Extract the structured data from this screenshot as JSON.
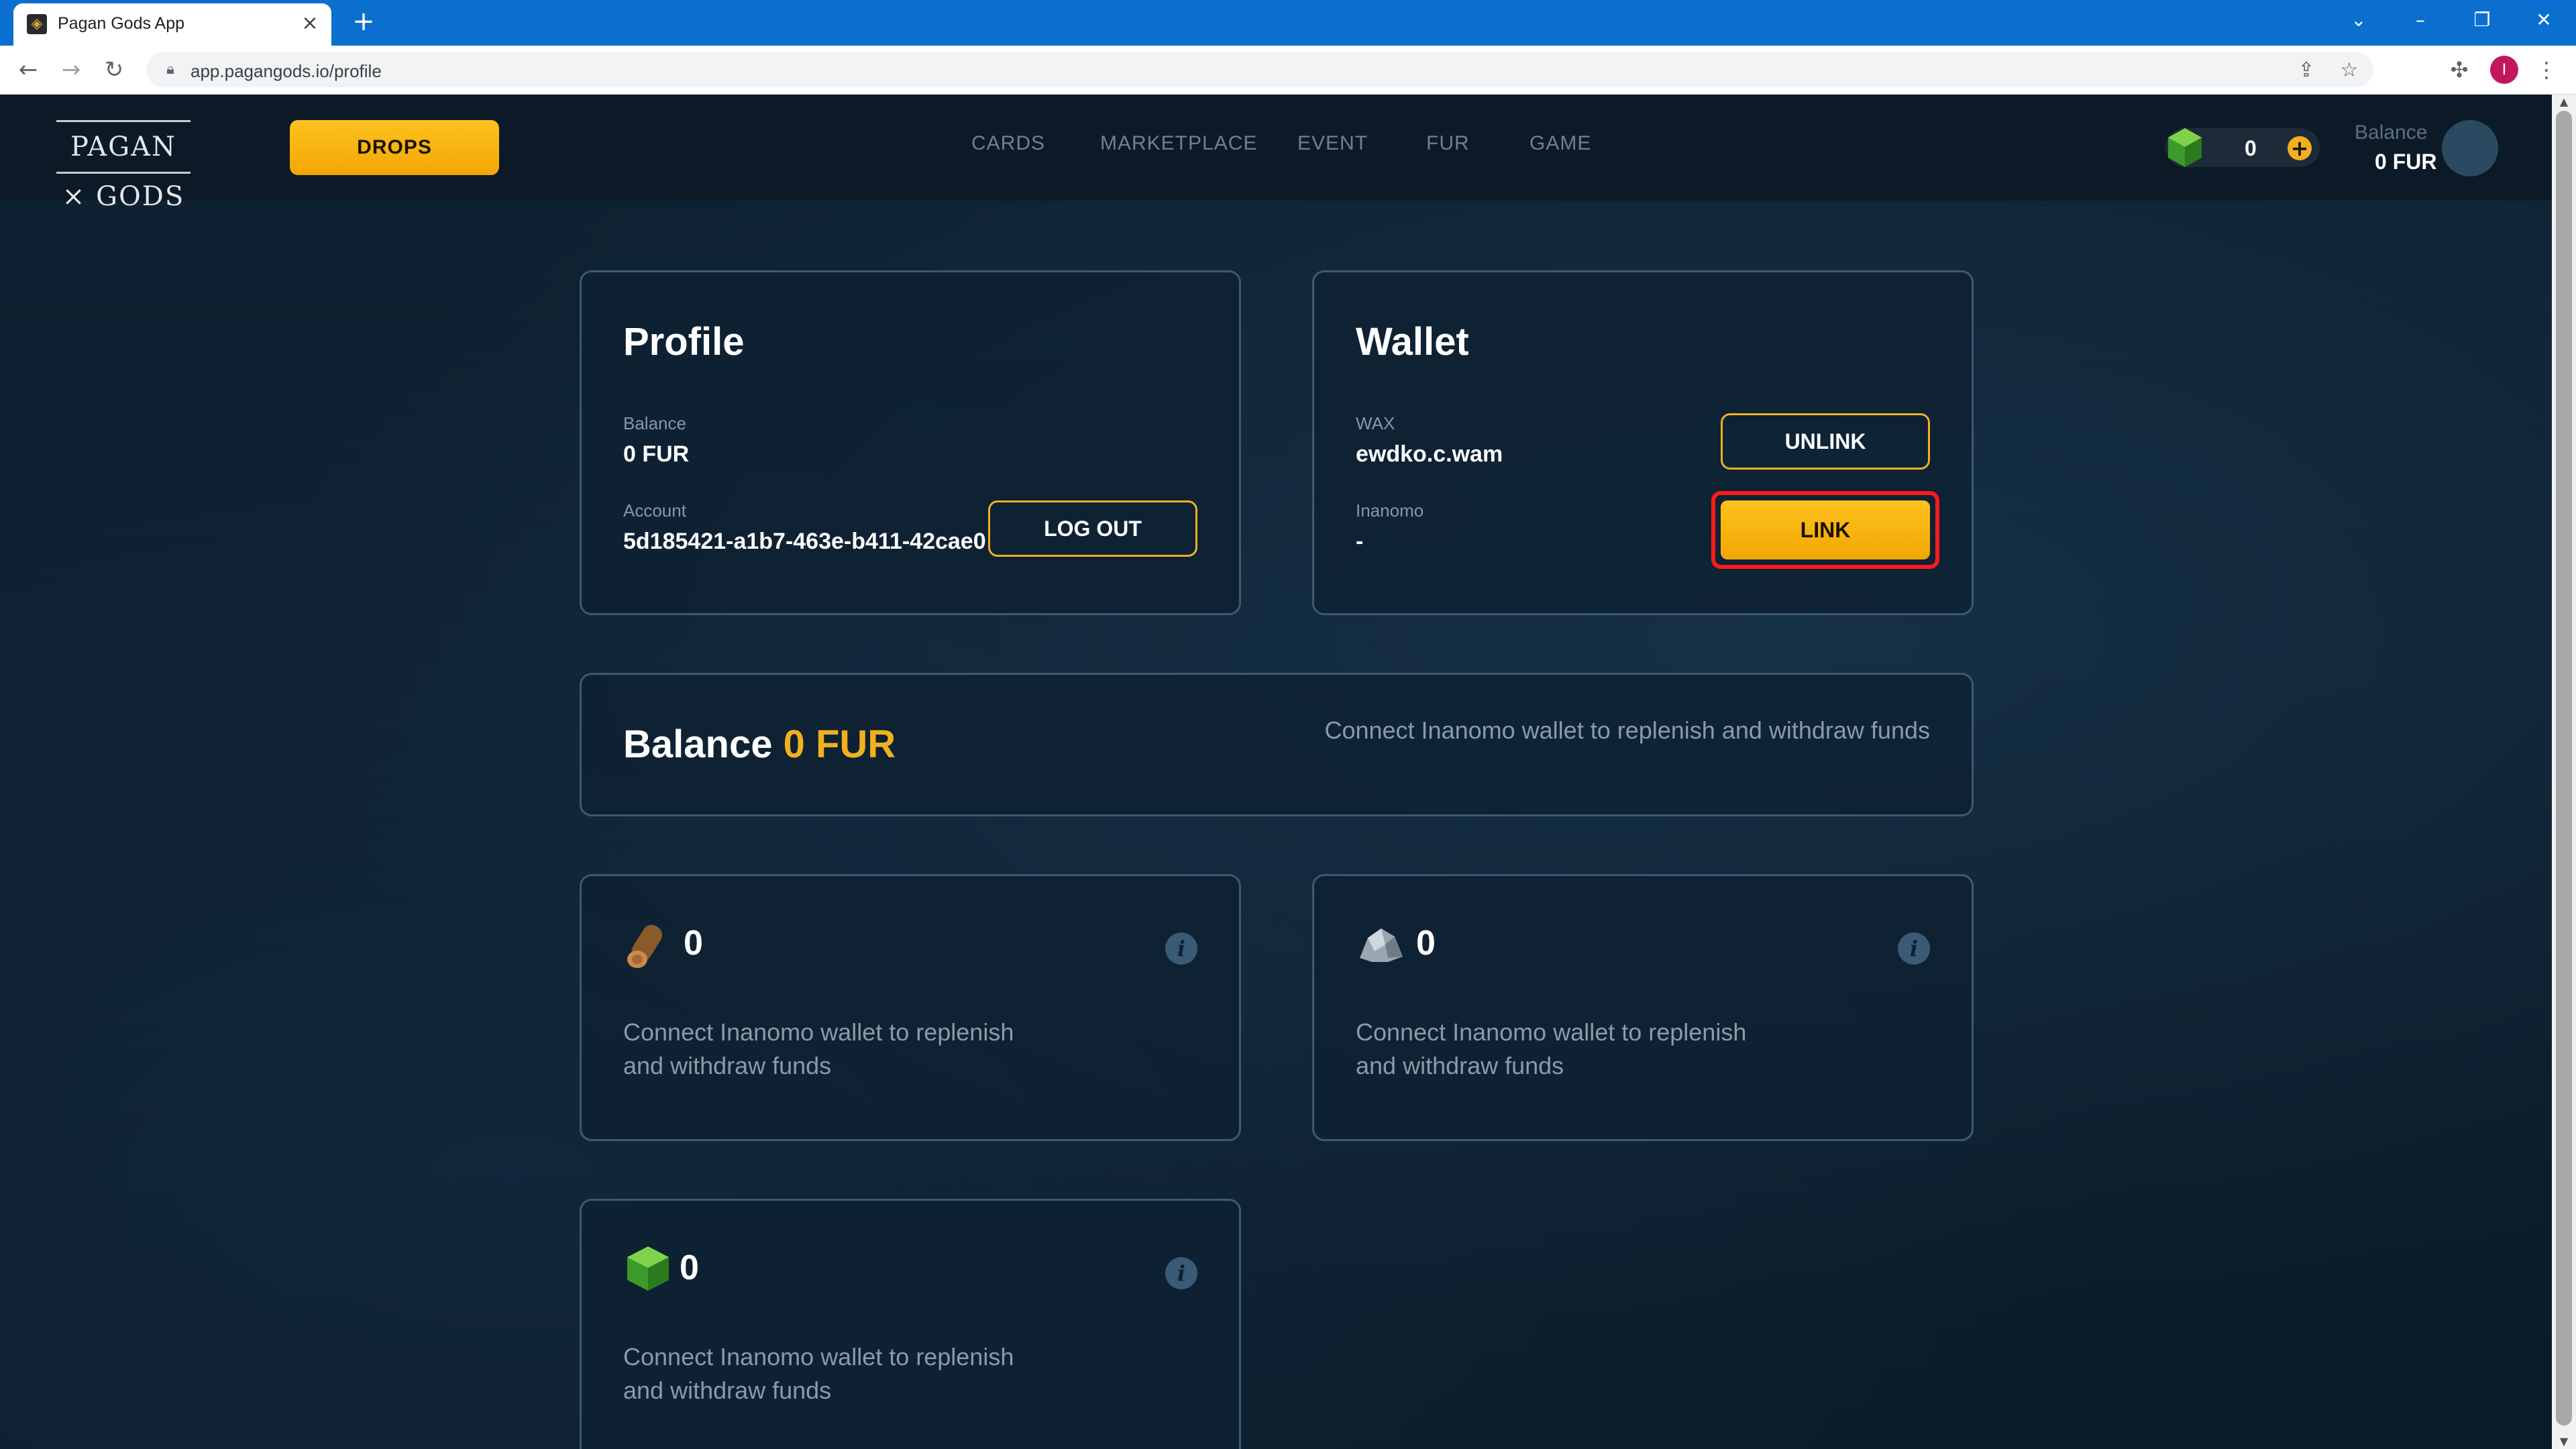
{
  "browser": {
    "tab_title": "Pagan Gods App",
    "tab_close": "×",
    "new_tab": "+",
    "url": "app.pagangods.io/profile",
    "profile_initial": "I",
    "window_controls": {
      "minimize": "–",
      "restore": "❐",
      "close": "✕",
      "tab_search": "⌄"
    }
  },
  "header": {
    "logo_text": "PAGAN × GODS",
    "drops_label": "DROPS",
    "nav": [
      "CARDS",
      "MARKETPLACE",
      "EVENT",
      "FUR",
      "GAME"
    ],
    "gem_count": "0",
    "gem_add": "+",
    "balance_label": "Balance",
    "balance_value": "0 FUR"
  },
  "profile_card": {
    "title": "Profile",
    "balance_label": "Balance",
    "balance_value": "0 FUR",
    "account_label": "Account",
    "account_value": "5d185421-a1b7-463e-b411-42cae0...",
    "logout_label": "LOG OUT"
  },
  "wallet_card": {
    "title": "Wallet",
    "wax_label": "WAX",
    "wax_value": "ewdko.c.wam",
    "unlink_label": "UNLINK",
    "inanomo_label": "Inanomo",
    "inanomo_value": "-",
    "link_label": "LINK"
  },
  "balance_card": {
    "label": "Balance",
    "value": "0 FUR",
    "hint": "Connect Inanomo wallet to replenish and withdraw funds"
  },
  "resources": [
    {
      "icon": "wood-log-icon",
      "count": "0",
      "hint_line1": "Connect Inanomo wallet to replenish",
      "hint_line2": "and withdraw funds"
    },
    {
      "icon": "stone-ore-icon",
      "count": "0",
      "hint_line1": "Connect Inanomo wallet to replenish",
      "hint_line2": "and withdraw funds"
    },
    {
      "icon": "green-gem-icon",
      "count": "0",
      "hint_line1": "Connect Inanomo wallet to replenish",
      "hint_line2": "and withdraw funds"
    }
  ],
  "info_glyph": "i",
  "colors": {
    "accent": "#f2b01e",
    "highlight": "#ff1a1a",
    "browser_blue": "#0b6fcf",
    "page_bg": "#0d1c2b"
  }
}
